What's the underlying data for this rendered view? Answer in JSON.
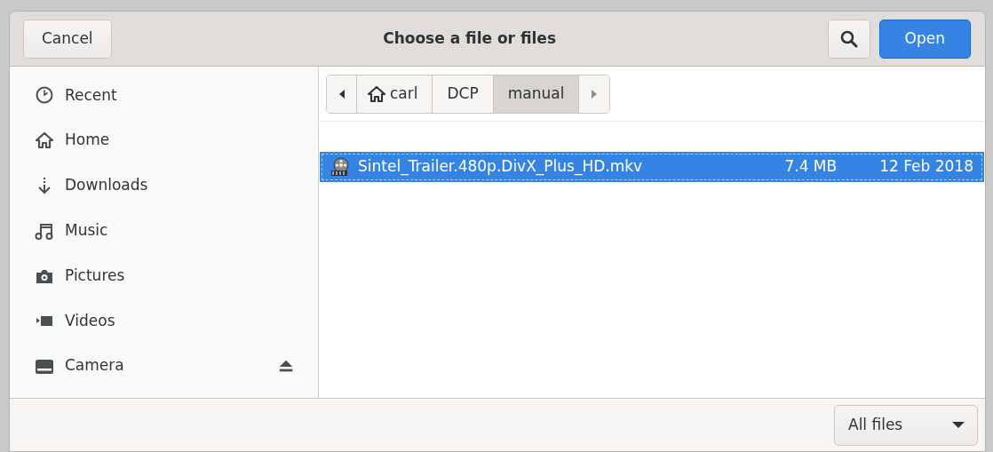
{
  "header": {
    "cancel": "Cancel",
    "title": "Choose a file or files",
    "open": "Open"
  },
  "sidebar": {
    "items": [
      {
        "kind": "recent",
        "label": "Recent",
        "ejectable": false
      },
      {
        "kind": "home",
        "label": "Home",
        "ejectable": false
      },
      {
        "kind": "downloads",
        "label": "Downloads",
        "ejectable": false
      },
      {
        "kind": "music",
        "label": "Music",
        "ejectable": false
      },
      {
        "kind": "pictures",
        "label": "Pictures",
        "ejectable": false
      },
      {
        "kind": "videos",
        "label": "Videos",
        "ejectable": false
      },
      {
        "kind": "drive",
        "label": "Camera",
        "ejectable": true
      }
    ]
  },
  "path_bar": {
    "segments": [
      {
        "kind": "home",
        "label": "carl",
        "selected": false
      },
      {
        "kind": "folder",
        "label": "DCP",
        "selected": false
      },
      {
        "kind": "folder",
        "label": "manual",
        "selected": true
      }
    ]
  },
  "files": [
    {
      "name": "Sintel_Trailer.480p.DivX_Plus_HD.mkv",
      "size": "7.4 MB",
      "modified": "12 Feb 2018",
      "selected": true
    }
  ],
  "filter": {
    "value": "All files"
  }
}
